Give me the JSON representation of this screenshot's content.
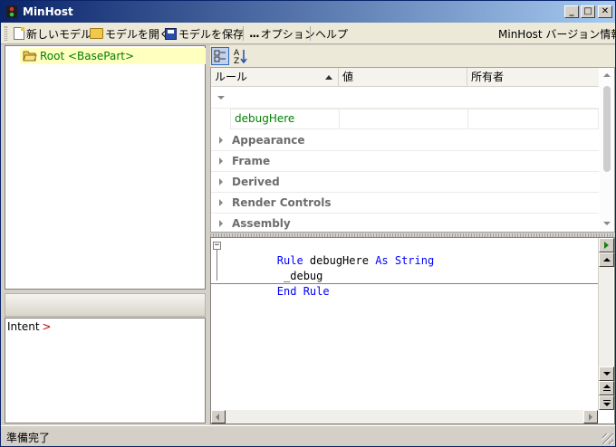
{
  "window": {
    "title": "MinHost"
  },
  "title_controls": {
    "minimize": "_",
    "maximize": "□",
    "close": "✕"
  },
  "toolbar": {
    "new_model": "新しいモデル",
    "open_model": "モデルを開く",
    "save_model": "モデルを保存",
    "options": "オプション",
    "help": "ヘルプ",
    "version_info": "MinHost バージョン情報..."
  },
  "tree": {
    "root_label": "Root <BasePart>"
  },
  "intent": {
    "label": "Intent",
    "caret": ">"
  },
  "property_grid": {
    "columns": [
      "ルール",
      "値",
      "所有者"
    ],
    "groups": [
      "Appearance",
      "Frame",
      "Derived",
      "Render Controls",
      "Assembly"
    ],
    "rules": [
      {
        "name": "debugHere",
        "value": "",
        "owner": ""
      }
    ]
  },
  "editor": {
    "lines": [
      {
        "parts": [
          {
            "t": "Rule",
            "kw": true
          },
          {
            "t": " debugHere "
          },
          {
            "t": "As String",
            "kw": true
          }
        ]
      },
      {
        "parts": [
          {
            "t": " _debug"
          }
        ]
      },
      {
        "parts": [
          {
            "t": "End Rule",
            "kw": true
          }
        ]
      }
    ]
  },
  "status": {
    "text": "準備完了"
  },
  "colors": {
    "tree_highlight": "#ffffc0",
    "rule_name": "#008000",
    "keyword": "#0000ff",
    "titlebar": "#0a246a"
  }
}
